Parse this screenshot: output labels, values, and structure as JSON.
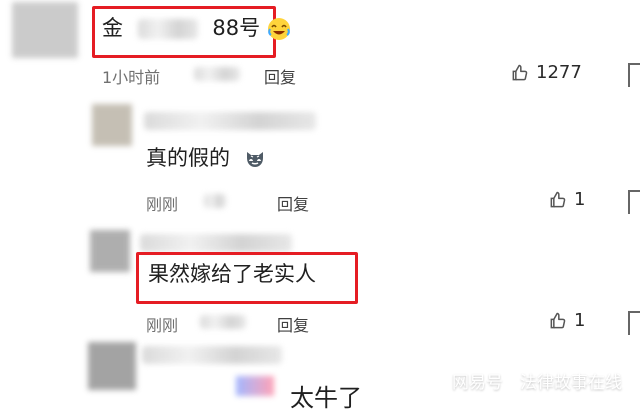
{
  "comments": [
    {
      "text_prefix": "金",
      "text_suffix": "88号",
      "time": "1小时前",
      "reply": "回复",
      "likes": "1277",
      "emoji": "laughing-cry-icon"
    },
    {
      "text": "真的假的",
      "time": "刚刚",
      "reply": "回复",
      "likes": "1",
      "emoji": "wolf-face-icon"
    },
    {
      "text": "果然嫁给了老实人",
      "time": "刚刚",
      "reply": "回复",
      "likes": "1"
    },
    {
      "text": "太牛了"
    }
  ],
  "watermark": {
    "left": "网易号",
    "right": "法律故事在线"
  }
}
